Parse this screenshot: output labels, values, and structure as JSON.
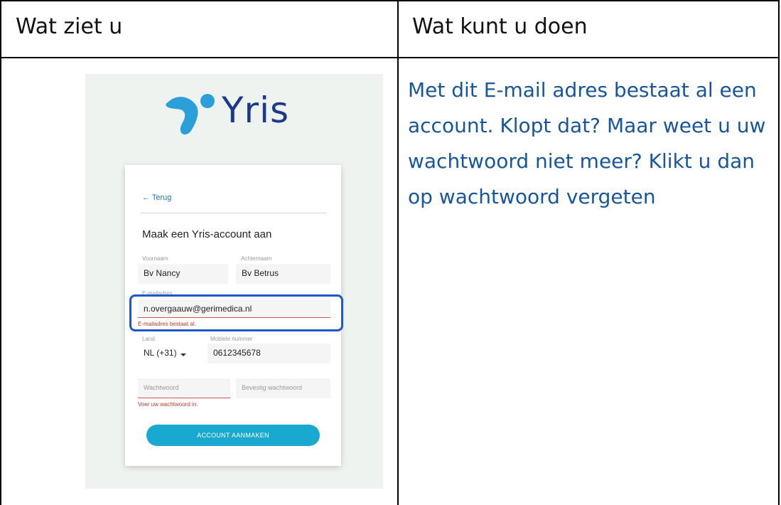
{
  "table": {
    "col1_header": "Wat ziet u",
    "col2_header": "Wat kunt u doen"
  },
  "screenshot": {
    "logo_text": "Yris",
    "back_link": "← Terug",
    "form_title": "Maak een Yris-account aan",
    "fields": {
      "first_name_label": "Voornaam",
      "first_name_value": "Bv Nancy",
      "last_name_label": "Achternaam",
      "last_name_value": "Bv Betrus",
      "email_label": "E-mailadres",
      "email_value": "n.overgaauw@gerimedica.nl",
      "email_error": "E-mailadres bestaat al.",
      "country_label": "Land",
      "country_value": "NL (+31)",
      "mobile_label": "Mobiele nummer",
      "mobile_value": "0612345678",
      "password_placeholder": "Wachtwoord",
      "password_error": "Voer uw wachtwoord in.",
      "confirm_password_placeholder": "Bevestig wachtwoord"
    },
    "submit_label": "ACCOUNT AANMAKEN",
    "colors": {
      "background": "#eef3f0",
      "accent": "#19a9d0",
      "logo_blue": "#1c3a8a",
      "error": "#d9534f",
      "highlight": "#1f58c8"
    }
  },
  "description": "Met dit E-mail adres bestaat al een account. Klopt dat? Maar weet u uw wachtwoord niet meer? Klikt u dan op wachtwoord vergeten",
  "icons": [
    "yris-logo-icon",
    "arrow-left-icon",
    "chevron-down-icon"
  ]
}
